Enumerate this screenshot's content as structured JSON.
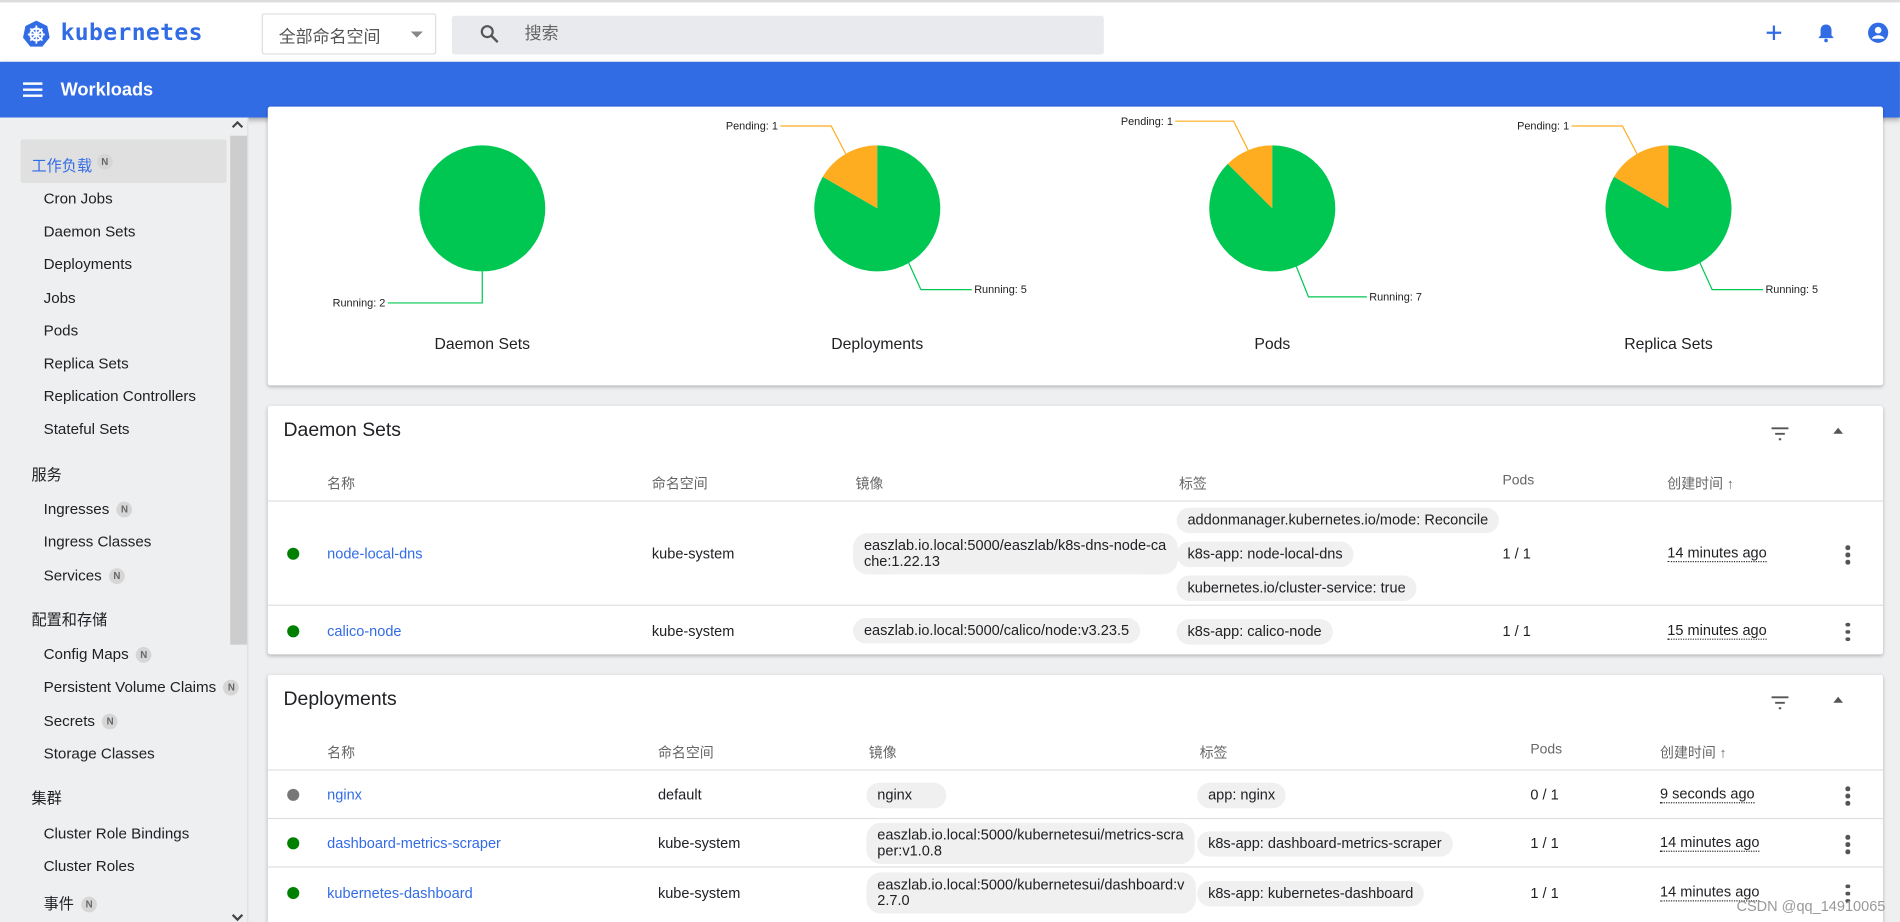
{
  "header": {
    "brand": "kubernetes",
    "namespace_select": "全部命名空间",
    "search_placeholder": "搜索",
    "page_title": "Workloads"
  },
  "sidebar": {
    "active": {
      "label": "工作负载",
      "badge": "N"
    },
    "workloads": [
      "Cron Jobs",
      "Daemon Sets",
      "Deployments",
      "Jobs",
      "Pods",
      "Replica Sets",
      "Replication Controllers",
      "Stateful Sets"
    ],
    "service_header": "服务",
    "services": [
      {
        "label": "Ingresses",
        "badge": "N"
      },
      {
        "label": "Ingress Classes"
      },
      {
        "label": "Services",
        "badge": "N"
      }
    ],
    "config_header": "配置和存储",
    "config": [
      {
        "label": "Config Maps",
        "badge": "N"
      },
      {
        "label": "Persistent Volume Claims",
        "badge": "N"
      },
      {
        "label": "Secrets",
        "badge": "N"
      },
      {
        "label": "Storage Classes"
      }
    ],
    "cluster_header": "集群",
    "cluster": [
      {
        "label": "Cluster Role Bindings"
      },
      {
        "label": "Cluster Roles"
      },
      {
        "label": "事件",
        "badge": "N"
      }
    ]
  },
  "colors": {
    "running": "#00c752",
    "pending": "#ffad20",
    "brand": "#326ce5",
    "ok": "#008000",
    "unknown": "#777777"
  },
  "charts": [
    {
      "title": "Daemon Sets",
      "running": 2,
      "pending": 0,
      "running_label": "Running: 2",
      "pending_label": ""
    },
    {
      "title": "Deployments",
      "running": 5,
      "pending": 1,
      "running_label": "Running: 5",
      "pending_label": "Pending: 1"
    },
    {
      "title": "Pods",
      "running": 7,
      "pending": 1,
      "running_label": "Running: 7",
      "pending_label": "Pending: 1"
    },
    {
      "title": "Replica Sets",
      "running": 5,
      "pending": 1,
      "running_label": "Running: 5",
      "pending_label": "Pending: 1"
    }
  ],
  "daemon_sets": {
    "title": "Daemon Sets",
    "columns": [
      "名称",
      "命名空间",
      "镜像",
      "标签",
      "Pods",
      "创建时间 ↑"
    ],
    "rows": [
      {
        "status": "ok",
        "name": "node-local-dns",
        "namespace": "kube-system",
        "image": [
          "easzlab.io.local:5000/easzlab/k8s-dns-node-ca",
          "che:1.22.13"
        ],
        "labels": [
          "addonmanager.kubernetes.io/mode: Reconcile",
          "k8s-app: node-local-dns",
          "kubernetes.io/cluster-service: true"
        ],
        "pods": "1 / 1",
        "created": "14 minutes ago"
      },
      {
        "status": "ok",
        "name": "calico-node",
        "namespace": "kube-system",
        "image": [
          "easzlab.io.local:5000/calico/node:v3.23.5"
        ],
        "labels": [
          "k8s-app: calico-node"
        ],
        "pods": "1 / 1",
        "created": "15 minutes ago"
      }
    ]
  },
  "deployments": {
    "title": "Deployments",
    "columns": [
      "名称",
      "命名空间",
      "镜像",
      "标签",
      "Pods",
      "创建时间 ↑"
    ],
    "rows": [
      {
        "status": "unknown",
        "name": "nginx",
        "namespace": "default",
        "image": [
          "nginx"
        ],
        "labels": [
          "app: nginx"
        ],
        "pods": "0 / 1",
        "created": "9 seconds ago"
      },
      {
        "status": "ok",
        "name": "dashboard-metrics-scraper",
        "namespace": "kube-system",
        "image": [
          "easzlab.io.local:5000/kubernetesui/metrics-scra",
          "per:v1.0.8"
        ],
        "labels": [
          "k8s-app: dashboard-metrics-scraper"
        ],
        "pods": "1 / 1",
        "created": "14 minutes ago"
      },
      {
        "status": "ok",
        "name": "kubernetes-dashboard",
        "namespace": "kube-system",
        "image": [
          "easzlab.io.local:5000/kubernetesui/dashboard:v",
          "2.7.0"
        ],
        "labels": [
          "k8s-app: kubernetes-dashboard"
        ],
        "pods": "1 / 1",
        "created": "14 minutes ago"
      }
    ]
  },
  "watermark": "CSDN @qq_14910065"
}
